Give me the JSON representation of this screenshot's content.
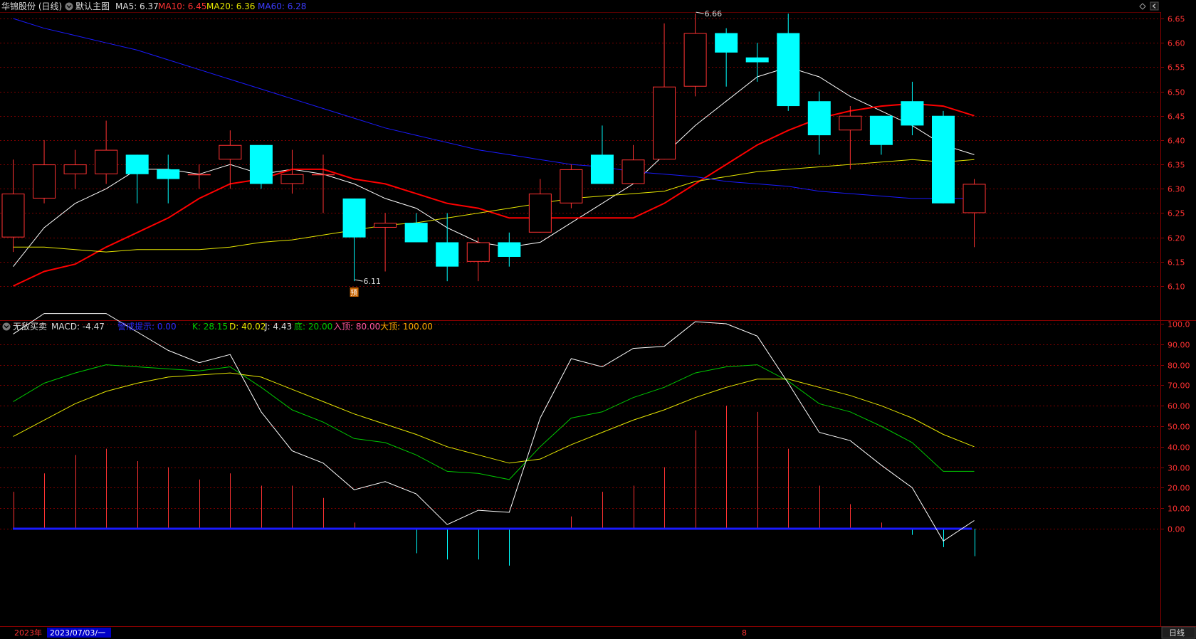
{
  "header": {
    "title": "华锦股份 (日线)",
    "main_chart_label": "默认主图",
    "ma5": "MA5: 6.37",
    "ma10": "MA10: 6.45",
    "ma20": "MA20: 6.36",
    "ma60": "MA60: 6.28"
  },
  "indicator_header": {
    "name": "无敌买卖",
    "macd": "MACD: -4.47",
    "warn": "警戒提示: 0.00",
    "k": "K: 28.15",
    "d": "D: 40.02",
    "j": "J: 4.43",
    "bottom": "底: 20.00",
    "entry_top": "入顶: 80.00",
    "big_top": "大顶: 100.00"
  },
  "bottom_bar": {
    "year": "2023年",
    "date": "2023/07/03/一",
    "mid_marker": "8",
    "period_button": "日线"
  },
  "colors": {
    "up": "#ff3232",
    "down": "#00ffff",
    "ma5": "#ffffff",
    "ma10": "#ff0000",
    "ma20": "#e6e600",
    "ma60": "#1a1aff",
    "k": "#00c800",
    "d": "#e6e600",
    "j": "#ffffff"
  },
  "chart_data": [
    {
      "type": "candlestick",
      "y_ticks": [
        "6.65",
        "6.60",
        "6.55",
        "6.50",
        "6.45",
        "6.40",
        "6.35",
        "6.30",
        "6.25",
        "6.20",
        "6.15",
        "6.10"
      ],
      "ylim": [
        6.09,
        6.67
      ],
      "annotations": [
        {
          "label": "6.66",
          "price": 6.66,
          "index": 22
        },
        {
          "label": "6.11",
          "price": 6.11,
          "index": 11
        },
        {
          "label": "预",
          "index": 11
        }
      ],
      "candles": [
        {
          "o": 6.2,
          "h": 6.36,
          "l": 6.17,
          "c": 6.29
        },
        {
          "o": 6.28,
          "h": 6.4,
          "l": 6.27,
          "c": 6.35
        },
        {
          "o": 6.33,
          "h": 6.38,
          "l": 6.3,
          "c": 6.35
        },
        {
          "o": 6.33,
          "h": 6.44,
          "l": 6.31,
          "c": 6.38
        },
        {
          "o": 6.37,
          "h": 6.37,
          "l": 6.27,
          "c": 6.33
        },
        {
          "o": 6.34,
          "h": 6.37,
          "l": 6.27,
          "c": 6.32
        },
        {
          "o": 6.33,
          "h": 6.35,
          "l": 6.3,
          "c": 6.33
        },
        {
          "o": 6.36,
          "h": 6.42,
          "l": 6.3,
          "c": 6.39
        },
        {
          "o": 6.39,
          "h": 6.39,
          "l": 6.3,
          "c": 6.31
        },
        {
          "o": 6.31,
          "h": 6.38,
          "l": 6.29,
          "c": 6.33
        },
        {
          "o": 6.33,
          "h": 6.37,
          "l": 6.25,
          "c": 6.33
        },
        {
          "o": 6.28,
          "h": 6.28,
          "l": 6.11,
          "c": 6.2
        },
        {
          "o": 6.22,
          "h": 6.25,
          "l": 6.13,
          "c": 6.23
        },
        {
          "o": 6.23,
          "h": 6.25,
          "l": 6.19,
          "c": 6.19
        },
        {
          "o": 6.19,
          "h": 6.25,
          "l": 6.11,
          "c": 6.14
        },
        {
          "o": 6.15,
          "h": 6.2,
          "l": 6.11,
          "c": 6.19
        },
        {
          "o": 6.19,
          "h": 6.21,
          "l": 6.14,
          "c": 6.16
        },
        {
          "o": 6.21,
          "h": 6.32,
          "l": 6.21,
          "c": 6.29
        },
        {
          "o": 6.27,
          "h": 6.35,
          "l": 6.26,
          "c": 6.34
        },
        {
          "o": 6.37,
          "h": 6.43,
          "l": 6.31,
          "c": 6.31
        },
        {
          "o": 6.31,
          "h": 6.39,
          "l": 6.31,
          "c": 6.36
        },
        {
          "o": 6.36,
          "h": 6.64,
          "l": 6.36,
          "c": 6.51
        },
        {
          "o": 6.51,
          "h": 6.66,
          "l": 6.49,
          "c": 6.62
        },
        {
          "o": 6.62,
          "h": 6.63,
          "l": 6.51,
          "c": 6.58
        },
        {
          "o": 6.57,
          "h": 6.6,
          "l": 6.52,
          "c": 6.56
        },
        {
          "o": 6.62,
          "h": 6.66,
          "l": 6.46,
          "c": 6.47
        },
        {
          "o": 6.48,
          "h": 6.5,
          "l": 6.37,
          "c": 6.41
        },
        {
          "o": 6.42,
          "h": 6.47,
          "l": 6.34,
          "c": 6.45
        },
        {
          "o": 6.45,
          "h": 6.45,
          "l": 6.37,
          "c": 6.39
        },
        {
          "o": 6.48,
          "h": 6.52,
          "l": 6.41,
          "c": 6.43
        },
        {
          "o": 6.45,
          "h": 6.46,
          "l": 6.27,
          "c": 6.27
        },
        {
          "o": 6.25,
          "h": 6.32,
          "l": 6.18,
          "c": 6.31
        }
      ],
      "series": [
        {
          "name": "MA5",
          "values": [
            6.14,
            6.22,
            6.27,
            6.3,
            6.34,
            6.34,
            6.33,
            6.35,
            6.33,
            6.34,
            6.33,
            6.31,
            6.28,
            6.26,
            6.22,
            6.19,
            6.18,
            6.19,
            6.23,
            6.27,
            6.31,
            6.37,
            6.43,
            6.48,
            6.53,
            6.55,
            6.53,
            6.49,
            6.46,
            6.43,
            6.39,
            6.37
          ]
        },
        {
          "name": "MA10",
          "values": [
            6.1,
            6.13,
            6.145,
            6.18,
            6.21,
            6.24,
            6.28,
            6.31,
            6.32,
            6.34,
            6.34,
            6.32,
            6.31,
            6.29,
            6.27,
            6.26,
            6.24,
            6.24,
            6.24,
            6.24,
            6.24,
            6.27,
            6.31,
            6.35,
            6.39,
            6.42,
            6.445,
            6.46,
            6.47,
            6.475,
            6.47,
            6.45
          ]
        },
        {
          "name": "MA20",
          "values": [
            6.18,
            6.18,
            6.175,
            6.17,
            6.175,
            6.175,
            6.175,
            6.18,
            6.19,
            6.195,
            6.205,
            6.215,
            6.225,
            6.23,
            6.24,
            6.25,
            6.26,
            6.27,
            6.28,
            6.285,
            6.29,
            6.295,
            6.315,
            6.325,
            6.335,
            6.34,
            6.345,
            6.35,
            6.355,
            6.36,
            6.355,
            6.36
          ]
        },
        {
          "name": "MA60",
          "values": [
            6.65,
            6.63,
            6.615,
            6.6,
            6.585,
            6.565,
            6.545,
            6.525,
            6.505,
            6.485,
            6.465,
            6.445,
            6.425,
            6.41,
            6.395,
            6.38,
            6.37,
            6.36,
            6.35,
            6.345,
            6.335,
            6.33,
            6.325,
            6.315,
            6.31,
            6.305,
            6.295,
            6.29,
            6.285,
            6.28,
            6.28,
            6.28
          ]
        }
      ]
    },
    {
      "type": "line",
      "y_ticks": [
        "100.0",
        "90.00",
        "80.00",
        "70.00",
        "60.00",
        "50.00",
        "40.00",
        "30.00",
        "20.00",
        "10.00",
        "0.00"
      ],
      "ylim": [
        -30,
        108
      ],
      "series": [
        {
          "name": "K",
          "values": [
            62,
            71,
            76,
            80,
            79,
            78,
            77,
            79,
            69,
            58,
            52,
            44,
            42,
            36,
            28,
            27,
            24,
            40,
            54,
            57,
            64,
            69,
            76,
            79,
            80,
            72,
            61,
            57,
            50,
            42,
            28,
            28
          ]
        },
        {
          "name": "D",
          "values": [
            45,
            53,
            61,
            67,
            71,
            74,
            75,
            76,
            74,
            68,
            62,
            56,
            51,
            46,
            40,
            36,
            32,
            34,
            41,
            47,
            53,
            58,
            64,
            69,
            73,
            73,
            69,
            65,
            60,
            54,
            46,
            40
          ]
        },
        {
          "name": "J",
          "values": [
            95,
            105,
            105,
            105,
            96,
            87,
            81,
            85,
            57,
            38,
            32,
            19,
            23,
            17,
            2,
            9,
            8,
            54,
            83,
            79,
            88,
            89,
            101,
            100,
            94,
            71,
            47,
            43,
            31,
            20,
            -6,
            4
          ]
        },
        {
          "name": "MACD",
          "values": [
            6,
            9,
            12,
            13,
            11,
            10,
            8,
            9,
            7,
            7,
            5,
            1,
            0,
            -4,
            -5,
            -5,
            -6,
            0,
            2,
            6,
            7,
            10,
            16,
            20,
            19,
            13,
            7,
            4,
            1,
            -1,
            -3,
            -4.47
          ]
        }
      ]
    }
  ]
}
